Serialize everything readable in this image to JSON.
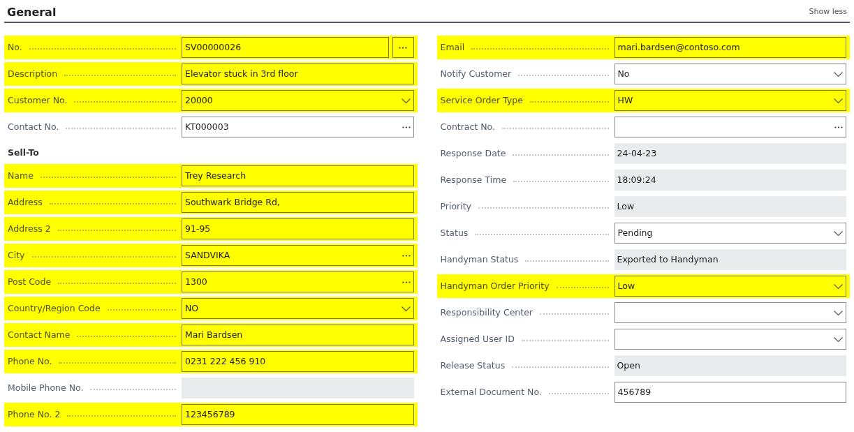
{
  "section": {
    "title": "General",
    "toggle": "Show less"
  },
  "left": [
    {
      "kind": "assist",
      "label": "No.",
      "value": "SV00000026",
      "highlighted": true
    },
    {
      "kind": "text",
      "label": "Description",
      "value": "Elevator stuck in 3rd floor",
      "highlighted": true
    },
    {
      "kind": "dropdown",
      "label": "Customer No.",
      "value": "20000",
      "highlighted": true
    },
    {
      "kind": "lookup",
      "label": "Contact No.",
      "value": "KT000003",
      "highlighted": false
    },
    {
      "kind": "heading",
      "label": "Sell-To"
    },
    {
      "kind": "text",
      "label": "Name",
      "value": "Trey Research",
      "highlighted": true
    },
    {
      "kind": "text",
      "label": "Address",
      "value": "Southwark Bridge Rd,",
      "highlighted": true
    },
    {
      "kind": "text",
      "label": "Address 2",
      "value": "91-95",
      "highlighted": true
    },
    {
      "kind": "lookup",
      "label": "City",
      "value": "SANDVIKA",
      "highlighted": true
    },
    {
      "kind": "lookup",
      "label": "Post Code",
      "value": "1300",
      "highlighted": true
    },
    {
      "kind": "dropdown",
      "label": "Country/Region Code",
      "value": "NO",
      "highlighted": true
    },
    {
      "kind": "text",
      "label": "Contact Name",
      "value": "Mari Bardsen",
      "highlighted": true
    },
    {
      "kind": "text",
      "label": "Phone No.",
      "value": "0231 222 456 910",
      "highlighted": true
    },
    {
      "kind": "readonly",
      "label": "Mobile Phone No.",
      "highlighted": false
    },
    {
      "kind": "text",
      "label": "Phone No. 2",
      "value": "123456789",
      "highlighted": true
    }
  ],
  "right": [
    {
      "kind": "text",
      "label": "Email",
      "value": "mari.bardsen@contoso.com",
      "highlighted": true
    },
    {
      "kind": "dropdown",
      "label": "Notify Customer",
      "value": "No",
      "highlighted": false
    },
    {
      "kind": "dropdown",
      "label": "Service Order Type",
      "value": "HW",
      "highlighted": true
    },
    {
      "kind": "lookup",
      "label": "Contract No.",
      "highlighted": false
    },
    {
      "kind": "readonly",
      "label": "Response Date",
      "value": "24-04-23",
      "highlighted": false
    },
    {
      "kind": "readonly",
      "label": "Response Time",
      "value": "18:09:24",
      "highlighted": false
    },
    {
      "kind": "readonly",
      "label": "Priority",
      "value": "Low",
      "highlighted": false
    },
    {
      "kind": "dropdown",
      "label": "Status",
      "value": "Pending",
      "highlighted": false
    },
    {
      "kind": "readonly",
      "label": "Handyman Status",
      "value": "Exported to Handyman",
      "highlighted": false
    },
    {
      "kind": "dropdown",
      "label": "Handyman Order Priority",
      "value": "Low",
      "highlighted": true
    },
    {
      "kind": "dropdown",
      "label": "Responsibility Center",
      "highlighted": false
    },
    {
      "kind": "dropdown",
      "label": "Assigned User ID",
      "highlighted": false
    },
    {
      "kind": "readonly",
      "label": "Release Status",
      "value": "Open",
      "highlighted": false
    },
    {
      "kind": "text",
      "label": "External Document No.",
      "value": "456789",
      "highlighted": false
    }
  ]
}
